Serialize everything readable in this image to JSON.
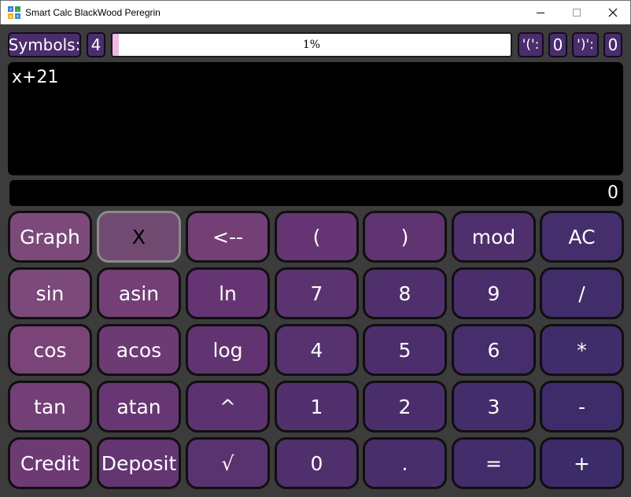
{
  "window": {
    "title": "Smart Calc BlackWood Peregrin",
    "minimize": "–",
    "maximize": "☐",
    "close": "✕"
  },
  "status": {
    "symbols_label": "Symbols:",
    "symbols_count": "4",
    "progress_text": "1%",
    "progress_value": 0.01,
    "open_paren_label": "'(':",
    "open_paren_count": "0",
    "close_paren_label": "')':",
    "close_paren_count": "0"
  },
  "expression": "x+21",
  "result": "0",
  "keys": [
    [
      {
        "label": "Graph",
        "name": "graph-button",
        "color": "#7b4a7a"
      },
      {
        "label": "X",
        "name": "x-button",
        "color": "#714a71",
        "selected": true
      },
      {
        "label": "<--",
        "name": "backspace-button",
        "color": "#733f75"
      },
      {
        "label": "(",
        "name": "open-paren-button",
        "color": "#643572"
      },
      {
        "label": ")",
        "name": "close-paren-button",
        "color": "#5f3471"
      },
      {
        "label": "mod",
        "name": "mod-button",
        "color": "#4f2f6c"
      },
      {
        "label": "AC",
        "name": "clear-button",
        "color": "#442e6c"
      }
    ],
    [
      {
        "label": "sin",
        "name": "sin-button",
        "color": "#7b4a7a"
      },
      {
        "label": "asin",
        "name": "asin-button",
        "color": "#733f75"
      },
      {
        "label": "ln",
        "name": "ln-button",
        "color": "#643572"
      },
      {
        "label": "7",
        "name": "digit-7-button",
        "color": "#5a3370"
      },
      {
        "label": "8",
        "name": "digit-8-button",
        "color": "#4f2f6c"
      },
      {
        "label": "9",
        "name": "digit-9-button",
        "color": "#4a2e6c"
      },
      {
        "label": "/",
        "name": "divide-button",
        "color": "#412d6a"
      }
    ],
    [
      {
        "label": "cos",
        "name": "cos-button",
        "color": "#7a4479"
      },
      {
        "label": "acos",
        "name": "acos-button",
        "color": "#6c3b73"
      },
      {
        "label": "log",
        "name": "log-button",
        "color": "#613471"
      },
      {
        "label": "4",
        "name": "digit-4-button",
        "color": "#56326f"
      },
      {
        "label": "5",
        "name": "digit-5-button",
        "color": "#4c2e6c"
      },
      {
        "label": "6",
        "name": "digit-6-button",
        "color": "#462d6b"
      },
      {
        "label": "*",
        "name": "multiply-button",
        "color": "#3f2d6a"
      }
    ],
    [
      {
        "label": "tan",
        "name": "tan-button",
        "color": "#723f76"
      },
      {
        "label": "atan",
        "name": "atan-button",
        "color": "#663772"
      },
      {
        "label": "^",
        "name": "power-button",
        "color": "#5c3370"
      },
      {
        "label": "1",
        "name": "digit-1-button",
        "color": "#52306e"
      },
      {
        "label": "2",
        "name": "digit-2-button",
        "color": "#4a2e6c"
      },
      {
        "label": "3",
        "name": "digit-3-button",
        "color": "#442d6b"
      },
      {
        "label": "-",
        "name": "subtract-button",
        "color": "#3d2c69"
      }
    ],
    [
      {
        "label": "Credit",
        "name": "credit-button",
        "color": "#6d3a74"
      },
      {
        "label": "Deposit",
        "name": "deposit-button",
        "color": "#633571"
      },
      {
        "label": "√",
        "name": "sqrt-button",
        "color": "#59336f"
      },
      {
        "label": "0",
        "name": "digit-0-button",
        "color": "#4f2f6c"
      },
      {
        "label": ".",
        "name": "decimal-button",
        "color": "#482e6b"
      },
      {
        "label": "=",
        "name": "equals-button",
        "color": "#422d6a"
      },
      {
        "label": "+",
        "name": "add-button",
        "color": "#3b2b69"
      }
    ]
  ]
}
